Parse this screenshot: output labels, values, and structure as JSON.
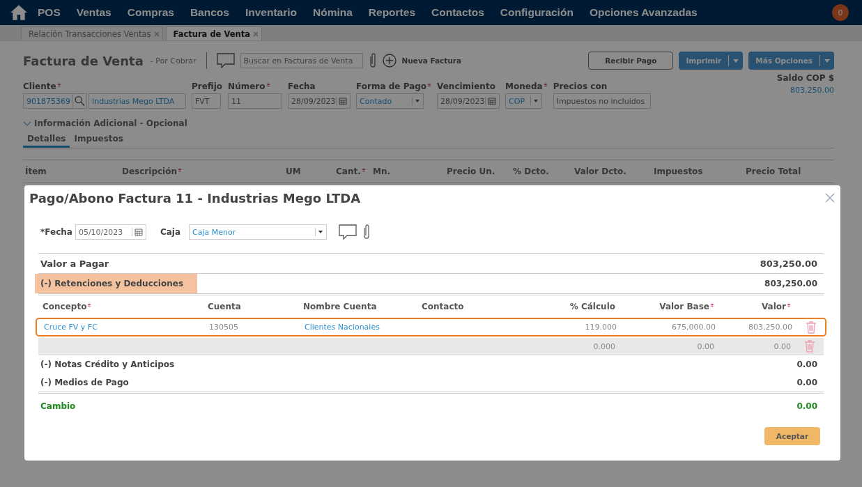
{
  "nav": {
    "items": [
      "POS",
      "Ventas",
      "Compras",
      "Bancos",
      "Inventario",
      "Nómina",
      "Reportes",
      "Contactos",
      "Configuración",
      "Opciones Avanzadas"
    ],
    "notifications": "0"
  },
  "tabs": [
    {
      "label": "Relación Transacciones Ventas",
      "selected": false
    },
    {
      "label": "Factura de Venta",
      "selected": true
    }
  ],
  "invoice": {
    "title": "Factura de Venta",
    "status": "- Por Cobrar",
    "search_placeholder": "Buscar en Facturas de Venta",
    "new_button": "Nueva Factura",
    "buttons": [
      {
        "label": "Recibir Pago",
        "kind": "outline"
      },
      {
        "label": "Imprimir",
        "kind": "split"
      },
      {
        "label": "Más Opciones",
        "kind": "split"
      }
    ],
    "fields": [
      {
        "label": "Cliente",
        "required": true,
        "kind": "lookup",
        "value": "901875369",
        "name": "Industrias Mego LTDA"
      },
      {
        "label": "Prefijo",
        "required": false,
        "kind": "text",
        "value": "FVT"
      },
      {
        "label": "Número",
        "required": true,
        "kind": "text",
        "value": "11"
      },
      {
        "label": "Fecha",
        "required": false,
        "kind": "date",
        "value": "28/09/2023"
      },
      {
        "label": "Forma de Pago",
        "required": true,
        "kind": "select",
        "value": "Contado"
      },
      {
        "label": "Vencimiento",
        "required": false,
        "kind": "date",
        "value": "28/09/2023"
      },
      {
        "label": "Moneda",
        "required": true,
        "kind": "select",
        "value": "COP"
      },
      {
        "label": "Precios con",
        "required": false,
        "kind": "text",
        "value": "Impuestos no incluidos"
      }
    ],
    "balance": {
      "label": "Saldo COP $",
      "value": "803,250.00"
    },
    "additional_info": "Información Adicional - Opcional",
    "subtabs": [
      {
        "label": "Detalles",
        "selected": true
      },
      {
        "label": "Impuestos",
        "selected": false
      }
    ],
    "columns": [
      {
        "label": "Ítem",
        "required": false
      },
      {
        "label": "Descripción",
        "required": true
      },
      {
        "label": "UM",
        "required": false
      },
      {
        "label": "Cant.",
        "required": true
      },
      {
        "label": "Mn.",
        "required": false
      },
      {
        "label": "Precio Un.",
        "required": false
      },
      {
        "label": "% Dcto.",
        "required": false
      },
      {
        "label": "Valor Dcto.",
        "required": false
      },
      {
        "label": "Impuestos",
        "required": false
      },
      {
        "label": "Precio Total",
        "required": false
      }
    ]
  },
  "modal": {
    "title": "Pago/Abono Factura 11 - Industrias Mego LTDA",
    "fecha": {
      "label": "*Fecha",
      "value": "05/10/2023"
    },
    "caja": {
      "label": "Caja",
      "value": "Caja Menor"
    },
    "amount_due": {
      "label": "Valor a Pagar",
      "value": "803,250.00"
    },
    "withholdings": {
      "label": "(-) Retenciones y Deducciones",
      "value": "803,250.00",
      "highlighted": true
    },
    "columns": [
      {
        "label": "Concepto",
        "required": true
      },
      {
        "label": "Cuenta",
        "required": false
      },
      {
        "label": "Nombre Cuenta",
        "required": false
      },
      {
        "label": "Contacto",
        "required": false
      },
      {
        "label": "% Cálculo",
        "required": false
      },
      {
        "label": "Valor Base",
        "required": true
      },
      {
        "label": "Valor",
        "required": true
      }
    ],
    "rows": [
      {
        "selected": true,
        "concepto": "Cruce FV y FC",
        "cuenta": "130505",
        "nombre_cuenta": "Clientes Nacionales",
        "calculo": "119.000",
        "valor_base": "675,000.00",
        "valor": "803,250.00"
      },
      {
        "selected": false,
        "calculo": "0.000",
        "valor_base": "0.00",
        "valor": "0.00"
      }
    ],
    "credit_notes": {
      "label": "(-) Notas Crédito y Anticipos",
      "value": "0.00"
    },
    "payment_methods": {
      "label": "(-) Medios de Pago",
      "value": "0.00"
    },
    "change": {
      "label": "Cambio",
      "value": "0.00"
    },
    "accept": "Aceptar"
  }
}
